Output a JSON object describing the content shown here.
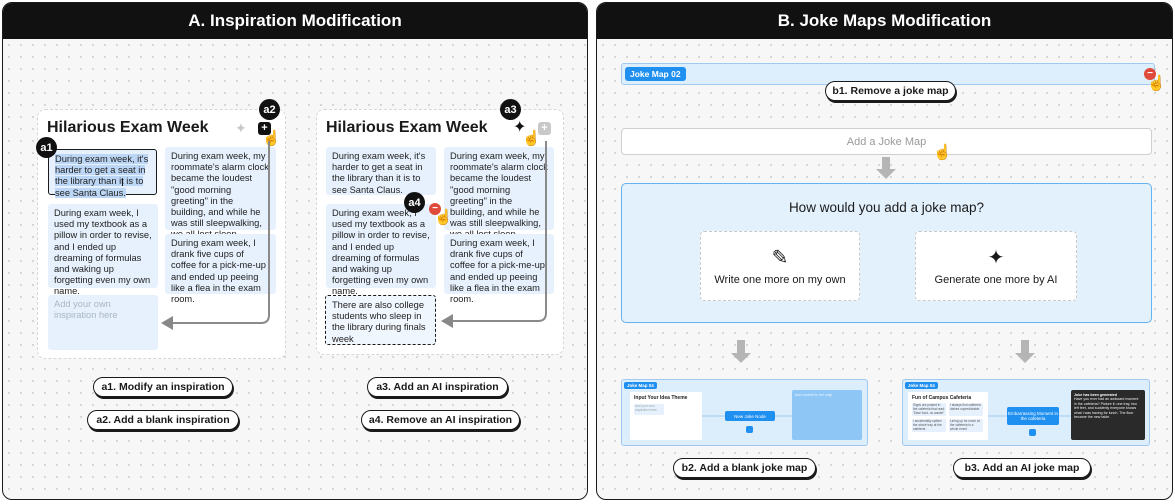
{
  "panel_a": {
    "title": "A. Inspiration Modification",
    "card_left": {
      "title": "Hilarious Exam Week",
      "notes": [
        "During exam week, it's harder to get a seat in the library than it is to see Santa Claus.",
        "During exam week, my roommate's alarm clock became the loudest \"good morning greeting\" in the building, and while he was still sleepwalking, we all lost sleep.",
        "During exam week, I used my textbook as a pillow in order to revise, and I ended up dreaming of formulas and waking up forgetting even my own name.",
        "During exam week, I drank five cups of coffee for a pick-me-up and ended up peeing like a flea in the exam room."
      ],
      "placeholder": "Add your own inspiration here"
    },
    "card_right": {
      "title": "Hilarious Exam Week",
      "notes": [
        "During exam week, it's harder to get a seat in the library than it is to see Santa Claus.",
        "During exam week, my roommate's alarm clock became the loudest \"good morning greeting\" in the building, and while he was still sleepwalking, we all lost sleep.",
        "During exam week, I used my textbook as a pillow in order to revise, and I ended up dreaming of formulas and waking up forgetting even my own name.",
        "During exam week, I drank five cups of coffee for a pick-me-up and ended up peeing like a flea in the exam room."
      ],
      "ai_note": "There are also college students who sleep in the library during finals week"
    },
    "badges": [
      "a1",
      "a2",
      "a3",
      "a4"
    ],
    "labels": {
      "a1": "a1. Modify an inspiration",
      "a2": "a2. Add a blank inspiration",
      "a3": "a3. Add an AI inspiration",
      "a4": "a4. Remove an AI inspiration"
    }
  },
  "panel_b": {
    "title": "B. Joke Maps Modification",
    "joke_map_tag": "Joke Map 02",
    "add_placeholder": "Add a Joke Map",
    "question": "How would you add a joke map?",
    "option_manual": "Write one more on my own",
    "option_ai": "Generate one more by AI",
    "labels": {
      "b1": "b1. Remove a joke map",
      "b2": "b2. Add a blank joke map",
      "b3": "b3. Add an AI joke map"
    },
    "thumb_blank": {
      "tag": "Joke Map 04",
      "theme": "Input Your Idea Theme",
      "note_placeholder": "Add your own inspiration here",
      "center": "New Joke Node",
      "right": "Add content to the map"
    },
    "thumb_ai": {
      "tag": "Joke Map 04",
      "theme": "Fun of Campus Cafeteria",
      "notes": [
        "Signs are posted in the cafeteria that read: 'Save food, no waste!'",
        "I always find cafeteria dishes unpredictable",
        "I accidentally spilled the whole tray at the cafeteria",
        "Lining up for lunch at the cafeteria is a whole event"
      ],
      "center": "Embarrassing Moment in the cafeteria",
      "right_head": "Joke has been generated",
      "right_body": "Have you ever had an awkward moment in the cafeteria? Picture it: one tray, two left feet, and suddenly everyone knows what I was having for lunch. The floor became the new table."
    }
  },
  "icons": {
    "sparkle": "✦",
    "plus": "+",
    "minus": "−",
    "hand": "☝",
    "pencil": "✎",
    "cursor_ibeam": "I"
  },
  "colors": {
    "note_bg": "#e6f1fd",
    "accent_blue": "#1f8ff0",
    "remove_red": "#e04a3a",
    "header_bg": "#111111"
  }
}
